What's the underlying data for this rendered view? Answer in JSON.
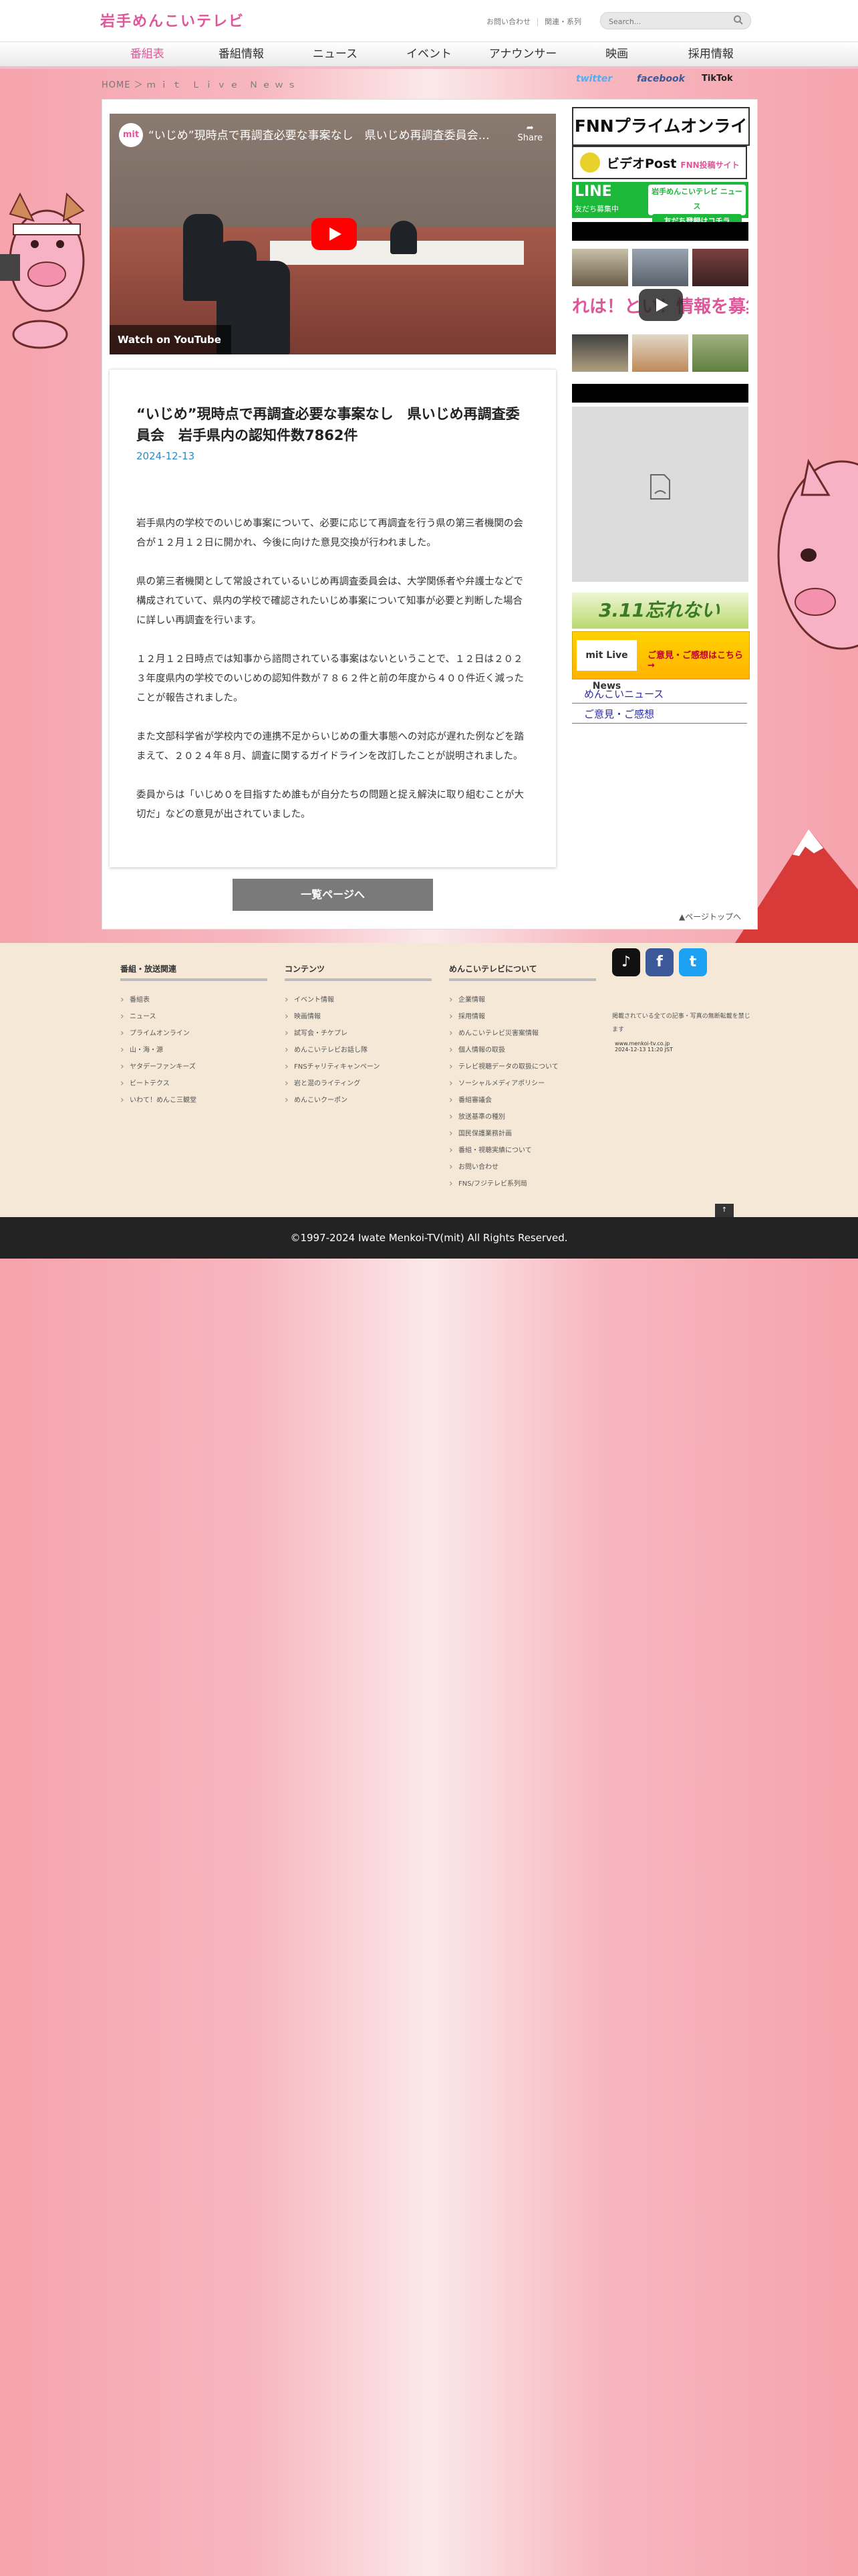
{
  "header": {
    "logo": "岩手めんこいテレビ",
    "links": [
      "お問い合わせ",
      "関連・系列"
    ],
    "search_placeholder": "Search..."
  },
  "nav": {
    "items": [
      "番組表",
      "番組情報",
      "ニュース",
      "イベント",
      "アナウンサー",
      "映画",
      "採用情報"
    ],
    "active": "番組表"
  },
  "breadcrumb": {
    "home": "HOME",
    "current": "ｍｉｔ Ｌｉｖｅ Ｎｅｗｓ"
  },
  "social": {
    "twitter": "twitter",
    "facebook": "facebook",
    "tiktok": "TikTok"
  },
  "video": {
    "title": "“いじめ”現時点で再調査必要な事案なし　県いじめ再調査委員会…",
    "channel_logo": "mit",
    "share": "Share",
    "watch": "Watch on YouTube"
  },
  "article": {
    "title": "“いじめ”現時点で再調査必要な事案なし　県いじめ再調査委員会　岩手県内の認知件数7862件",
    "date": "2024-12-13",
    "paragraphs": [
      "岩手県内の学校でのいじめ事案について、必要に応じて再調査を行う県の第三者機関の会合が１２月１２日に開かれ、今後に向けた意見交換が行われました。",
      "県の第三者機関として常設されているいじめ再調査委員会は、大学関係者や弁護士などで構成されていて、県内の学校で確認されたいじめ事案について知事が必要と判断した場合に詳しい再調査を行います。",
      "１２月１２日時点では知事から諮問されている事案はないということで、１２日は２０２３年度県内の学校でのいじめの認知件数が７８６２件と前の年度から４００件近く減ったことが報告されました。",
      "また文部科学省が学校内での連携不足からいじめの重大事態への対応が遅れた例などを踏まえて、２０２４年８月、調査に関するガイドラインを改訂したことが説明されました。",
      "委員からは「いじめ０を目指すため誰もが自分たちの問題と捉え解決に取り組むことが大切だ」などの意見が出されていました。"
    ]
  },
  "list_button": "一覧ページへ",
  "page_top": "▲ページトップへ",
  "sidebar": {
    "fnn": "FNNプライムオンライン",
    "videopost": "ビデオPost",
    "videopost_sub": "FNN投稿サイト",
    "line_left": "LINE",
    "line_left_sub": "友だち募集中",
    "line_right": "岩手めんこいテレビ ニュース",
    "line_right_sub": "友だち登録はコチラ",
    "banner_text": "れは！とい！情報を募集中",
    "b311": "3.11忘れない",
    "livenews": "mit Live News",
    "livenews_sub": "ご意見・ご感想はこちら→",
    "links": [
      "めんこいニュース",
      "ご意見・ご感想"
    ]
  },
  "footer": {
    "col1": {
      "heading": "番組・放送関連",
      "items": [
        "番組表",
        "ニュース",
        "プライムオンライン",
        "山・海・源",
        "ヤタデーファンキーズ",
        "ビートテクス",
        "いわて！めんこ三観堂"
      ]
    },
    "col2": {
      "heading": "コンテンツ",
      "items": [
        "イベント情報",
        "映画情報",
        "試写会・チケプレ",
        "めんこいテレビお話し隊",
        "FNSチャリティキャンペーン",
        "岩と混のライティング",
        "めんこいクーポン"
      ]
    },
    "col3": {
      "heading": "めんこいテレビについて",
      "items": [
        "企業情報",
        "採用情報",
        "めんこいテレビ災害案情報",
        "個人情報の取扱",
        "テレビ視聴データの取扱について",
        "ソーシャルメディアポリシー",
        "番組審議会",
        "放送基準の種別",
        "国民保護業務計画",
        "番組・視聴実績について",
        "お問い合わせ",
        "FNS/フジテレビ系列局"
      ]
    },
    "note": "掲載されている全ての記事・写真の無断転載を禁じます",
    "badge": "www.menkoi-tv.co.jp 2024-12-13 11:20 JST",
    "top_btn": "↑"
  },
  "copyright": "©1997-2024 Iwate Menkoi-TV(mit) All Rights Reserved."
}
